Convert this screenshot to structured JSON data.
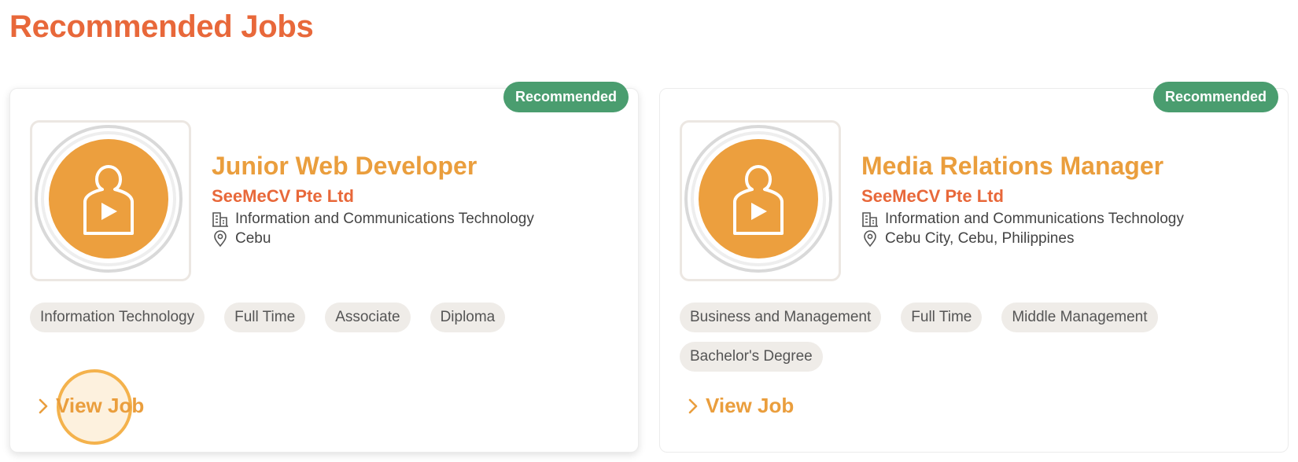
{
  "page": {
    "title": "Recommended Jobs"
  },
  "colors": {
    "accent_orange": "#e8683a",
    "title_orange": "#ea9e3d",
    "badge_green": "#4a9d6f",
    "chip_bg": "#efece8"
  },
  "jobs": [
    {
      "badge": "Recommended",
      "title": "Junior Web Developer",
      "company": "SeeMeCV Pte Ltd",
      "industry": "Information and Communications Technology",
      "location": "Cebu",
      "tags": [
        "Information Technology",
        "Full Time",
        "Associate",
        "Diploma"
      ],
      "view_label": "View Job",
      "logo_icon": "person-play-icon"
    },
    {
      "badge": "Recommended",
      "title": "Media Relations Manager",
      "company": "SeeMeCV Pte Ltd",
      "industry": "Information and Communications Technology",
      "location": "Cebu City, Cebu, Philippines",
      "tags": [
        "Business and Management",
        "Full Time",
        "Middle Management",
        "Bachelor's Degree"
      ],
      "view_label": "View Job",
      "logo_icon": "person-play-icon"
    }
  ]
}
